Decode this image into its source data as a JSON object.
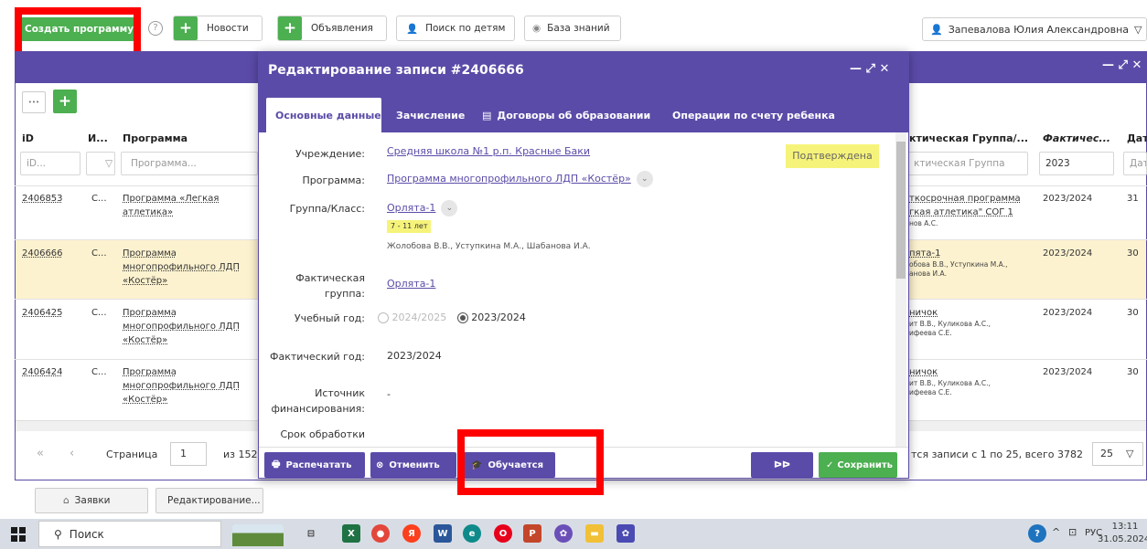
{
  "toolbar": {
    "create_program": "Создать программу",
    "help": "?",
    "news": "Новости",
    "ads": "Объявления",
    "children_search": "Поиск по детям",
    "knowledge_base": "База знаний",
    "user": "Запевалова Юлия Александровна"
  },
  "grid": {
    "header_controls": "— ⤢ ✕",
    "dots_btn": "•••",
    "columns": {
      "id": "iD",
      "i": "И...",
      "program": "Программа",
      "fact_group": "ктическая Группа/...",
      "fact_year": "Фактичес...",
      "date": "Дата"
    },
    "filters": {
      "id": "iD...",
      "program": "Программа...",
      "fact_group": "ктическая Группа",
      "fact_year": "2023",
      "date": "Дат"
    },
    "rows": [
      {
        "id": "2406853",
        "i": "С...",
        "program": [
          "Программа «Легкая",
          "атлетика»"
        ],
        "group": [
          "ткосрочная программа",
          "гкая атлетика\" СОГ 1"
        ],
        "group_small": [
          "нов А.С."
        ],
        "year": "2023/2024",
        "date": "31"
      },
      {
        "id": "2406666",
        "i": "С...",
        "program": [
          "Программа",
          "многопрофильного ЛДП",
          "«Костёр»"
        ],
        "group": [
          "пята-1"
        ],
        "group_small": [
          "обова В.В., Уступкина М.А.,",
          "анова И.А."
        ],
        "year": "2023/2024",
        "date": "30"
      },
      {
        "id": "2406425",
        "i": "С...",
        "program": [
          "Программа",
          "многопрофильного ЛДП",
          "«Костёр»"
        ],
        "group": [
          "ничок"
        ],
        "group_small": [
          "ит В.В., Куликова А.С.,",
          "ифеева С.Е."
        ],
        "year": "2023/2024",
        "date": "30"
      },
      {
        "id": "2406424",
        "i": "С...",
        "program": [
          "Программа",
          "многопрофильного ЛДП",
          "«Костёр»"
        ],
        "group": [
          "ничок"
        ],
        "group_small": [
          "ит В.В., Куликова А.С.,",
          "ифеева С.Е."
        ],
        "year": "2023/2024",
        "date": "30"
      }
    ],
    "pager": {
      "page_label": "Страница",
      "page": "1",
      "of": "из 152",
      "records": "тся записи с 1 по 25, всего 3782",
      "per_page": "25"
    }
  },
  "modal": {
    "title": "Редактирование записи #2406666",
    "controls": "— ⤢ ✕",
    "tabs": [
      "Основные данные",
      "Зачисление",
      "Договоры об образовании",
      "Операции по счету ребенка"
    ],
    "status": "Подтверждена",
    "fields": {
      "institution_label": "Учреждение:",
      "institution": "Средняя школа №1 р.п. Красные Баки",
      "program_label": "Программа:",
      "program": "Программа многопрофильного ЛДП «Костёр»",
      "group_label": "Группа/Класс:",
      "group": "Орлята-1",
      "age": "7 - 11 лет",
      "teachers": "Жолобова В.В., Уступкина М.А., Шабанова И.А.",
      "fact_group_label_1": "Фактическая",
      "fact_group_label_2": "группа:",
      "fact_group": "Орлята-1",
      "school_year_label": "Учебный год:",
      "year_option_1": "2024/2025",
      "year_option_2": "2023/2024",
      "fact_year_label": "Фактический год:",
      "fact_year": "2023/2024",
      "funding_label_1": "Источник",
      "funding_label_2": "финансирования:",
      "funding": "-",
      "deadline_label": "Срок обработки"
    },
    "buttons": {
      "print": "Распечатать",
      "cancel": "Отменить",
      "studying": "Обучается",
      "next": "ᐅᐅ",
      "save": "Сохранить"
    }
  },
  "bottom_tabs": {
    "requests": "Заявки",
    "editing": "Редактирование..."
  },
  "taskbar": {
    "search": "Поиск",
    "lang": "РУС",
    "time": "13:11",
    "date": "31.05.2024"
  }
}
